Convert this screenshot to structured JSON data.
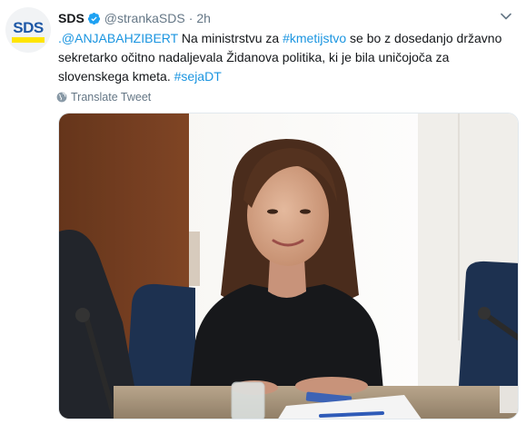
{
  "author": {
    "display_name": "SDS",
    "handle": "@strankaSDS",
    "separator": "·",
    "time": "2h",
    "avatar_logo_text": "SDS",
    "verified_icon": "verified-badge-icon"
  },
  "tweet": {
    "lines": [
      {
        "mention": ".@ANJABAHZIBERT",
        "text_before_hashtag": " Na ministrstvu za ",
        "hashtag": "#kmetijstvo",
        "text_after": " se bo z dosedanjo državno"
      },
      {
        "text": "sekretarko očitno nadaljevala Židanova politika, ki je bila uničojoča za"
      },
      {
        "text": "slovenskega kmeta. ",
        "hashtag": "#sejaDT"
      }
    ]
  },
  "actions": {
    "translate_label": "Translate Tweet",
    "menu_icon": "chevron-down-icon",
    "translate_icon": "globe-icon"
  },
  "media": {
    "type": "photo",
    "description_icon": "photo-image"
  },
  "colors": {
    "link": "#1b95e0",
    "muted": "#657786",
    "text": "#14171a",
    "verified": "#1da1f2",
    "logo_blue": "#1e58a6",
    "logo_yellow": "#ffe500"
  }
}
